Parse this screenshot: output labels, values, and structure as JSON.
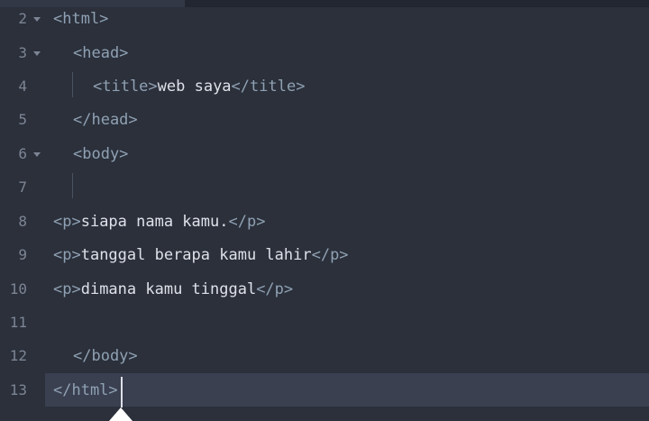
{
  "lines": [
    {
      "num": "2",
      "fold": true,
      "tag_open": "<html>",
      "text": "",
      "tag_close": ""
    },
    {
      "num": "3",
      "fold": true,
      "tag_open": "<head>",
      "text": "",
      "tag_close": ""
    },
    {
      "num": "4",
      "fold": false,
      "tag_open": "<title>",
      "text": "web saya",
      "tag_close": "</title>"
    },
    {
      "num": "5",
      "fold": false,
      "tag_open": "</head>",
      "text": "",
      "tag_close": ""
    },
    {
      "num": "6",
      "fold": true,
      "tag_open": "<body>",
      "text": "",
      "tag_close": ""
    },
    {
      "num": "7",
      "fold": false,
      "tag_open": "",
      "text": "",
      "tag_close": ""
    },
    {
      "num": "8",
      "fold": false,
      "tag_open": "<p>",
      "text": "siapa nama kamu.",
      "tag_close": "</p>"
    },
    {
      "num": "9",
      "fold": false,
      "tag_open": "<p>",
      "text": "tanggal berapa kamu lahir",
      "tag_close": "</p>"
    },
    {
      "num": "10",
      "fold": false,
      "tag_open": "<p>",
      "text": "dimana kamu tinggal",
      "tag_close": "</p>"
    },
    {
      "num": "11",
      "fold": false,
      "tag_open": "",
      "text": "",
      "tag_close": ""
    },
    {
      "num": "12",
      "fold": false,
      "tag_open": "</body>",
      "text": "",
      "tag_close": ""
    },
    {
      "num": "13",
      "fold": false,
      "tag_open": "</html>",
      "text": "",
      "tag_close": ""
    }
  ],
  "active_line": "13",
  "colors": {
    "background": "#2b303b",
    "active_line": "#3a4050",
    "tag": "#8fa1b3",
    "text": "#dfe1e8",
    "line_number": "#7d8594"
  },
  "icons": {
    "fold": "chevron-down-icon",
    "cursor_handle": "caret-handle-icon"
  }
}
